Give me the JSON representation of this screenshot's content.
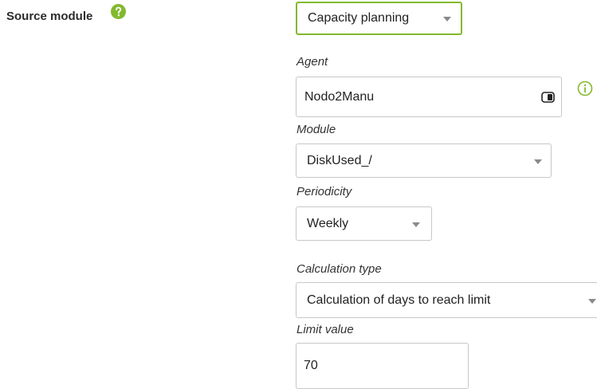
{
  "source": {
    "label": "Source module",
    "selected": "Capacity planning"
  },
  "agent": {
    "label": "Agent",
    "value": "Nodo2Manu"
  },
  "module": {
    "label": "Module",
    "selected": "DiskUsed_/"
  },
  "periodicity": {
    "label": "Periodicity",
    "selected": "Weekly"
  },
  "calculation": {
    "label": "Calculation type",
    "selected": "Calculation of days to reach limit"
  },
  "limit": {
    "label": "Limit value",
    "value": "70"
  },
  "colors": {
    "accent_green": "#82b92e",
    "help_icon": "#82b92e",
    "border": "#c7c7c7"
  },
  "icons": {
    "help": "help-icon",
    "info": "info-icon",
    "agent_field": "cursor-icon",
    "dropdown": "caret-down-icon"
  }
}
